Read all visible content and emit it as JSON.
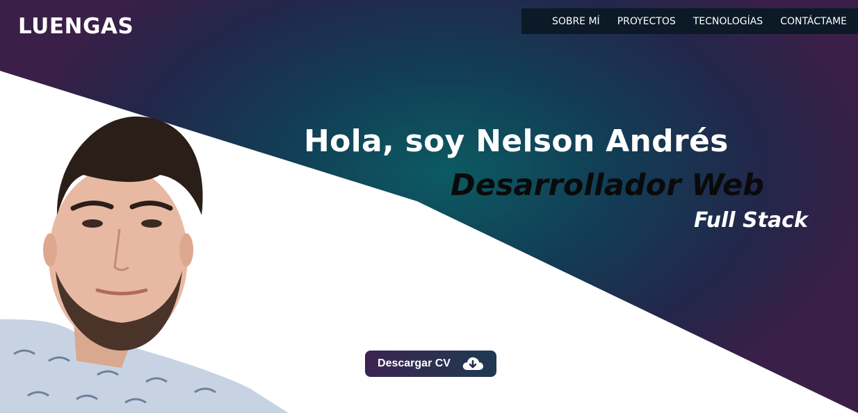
{
  "brand": {
    "logo_text": "LUENGAS"
  },
  "nav": {
    "items": [
      {
        "label": "SOBRE MÍ"
      },
      {
        "label": "PROYECTOS"
      },
      {
        "label": "TECNOLOGÍAS"
      },
      {
        "label": "CONTÁCTAME"
      }
    ]
  },
  "hero": {
    "greeting": "Hola, soy Nelson Andrés",
    "role": "Desarrollador Web",
    "specialty": "Full Stack",
    "cv_button_label": "Descargar CV",
    "cv_button_icon": "cloud-download-icon",
    "portrait": "profile-photo"
  },
  "colors": {
    "nav_background": "#0b1a26",
    "hero_teal": "#0c5a62",
    "hero_purple": "#3a1f48",
    "button_start": "#3c2450",
    "button_end": "#1e3a52"
  }
}
